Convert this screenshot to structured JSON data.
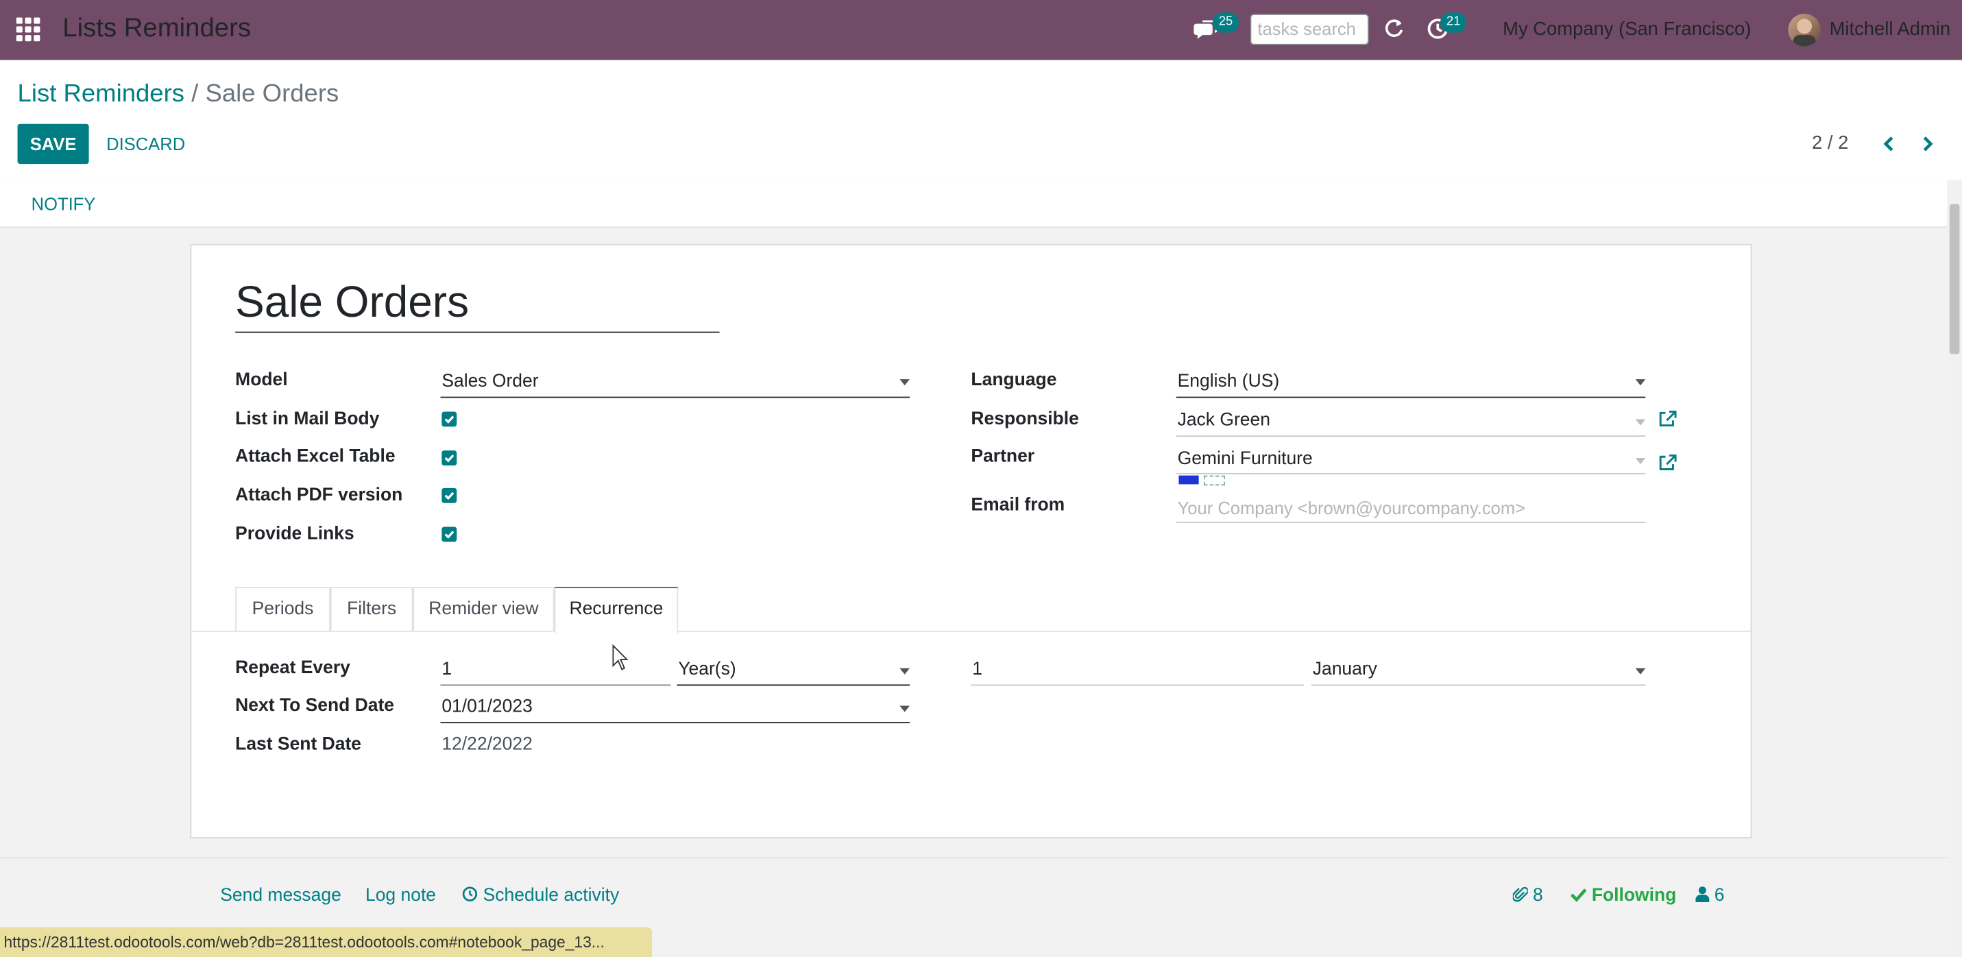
{
  "navbar": {
    "app_title": "Lists Reminders",
    "messages_count": "25",
    "search_placeholder": "tasks search",
    "activities_count": "21",
    "company": "My Company (San Francisco)",
    "user": "Mitchell Admin"
  },
  "breadcrumb": {
    "parent": "List Reminders",
    "separator": " / ",
    "current": "Sale Orders"
  },
  "buttons": {
    "save": "SAVE",
    "discard": "DISCARD",
    "notify": "NOTIFY"
  },
  "pager": {
    "value": "2 / 2"
  },
  "record": {
    "name": "Sale Orders",
    "left_fields": {
      "model_label": "Model",
      "model_value": "Sales Order",
      "list_in_mail_label": "List in Mail Body",
      "list_in_mail": true,
      "attach_excel_label": "Attach Excel Table",
      "attach_excel": true,
      "attach_pdf_label": "Attach PDF version",
      "attach_pdf": true,
      "provide_links_label": "Provide Links",
      "provide_links": true
    },
    "right_fields": {
      "language_label": "Language",
      "language_value": "English (US)",
      "responsible_label": "Responsible",
      "responsible_value": "Jack Green",
      "partner_label": "Partner",
      "partner_value": "Gemini Furniture",
      "email_from_label": "Email from",
      "email_from_placeholder": "Your Company <brown@yourcompany.com>"
    }
  },
  "tabs": [
    {
      "label": "Periods",
      "active": false
    },
    {
      "label": "Filters",
      "active": false
    },
    {
      "label": "Remider view",
      "active": false
    },
    {
      "label": "Recurrence",
      "active": true
    }
  ],
  "recurrence": {
    "repeat_every_label": "Repeat Every",
    "repeat_every_value": "1",
    "repeat_unit": "Year(s)",
    "day_value": "1",
    "month_value": "January",
    "next_send_label": "Next To Send Date",
    "next_send_value": "01/01/2023",
    "last_sent_label": "Last Sent Date",
    "last_sent_value": "12/22/2022"
  },
  "chatter": {
    "send_message": "Send message",
    "log_note": "Log note",
    "schedule_activity": "Schedule activity",
    "attachments_count": "8",
    "following": "Following",
    "followers_count": "6"
  },
  "status_url": "https://2811test.odootools.com/web?db=2811test.odootools.com#notebook_page_13...",
  "colors": {
    "brand": "#714b67",
    "accent": "#017e84",
    "following": "#28a745"
  }
}
